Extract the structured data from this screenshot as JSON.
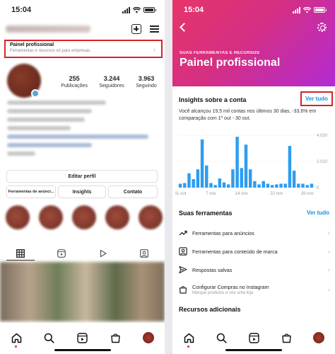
{
  "left": {
    "status_time": "15:04",
    "professional_panel": {
      "title": "Painel profissional",
      "subtitle": "Ferramentas e recursos só para empresas."
    },
    "stats": [
      {
        "value": "255",
        "label": "Publicações"
      },
      {
        "value": "3.244",
        "label": "Seguidores"
      },
      {
        "value": "3.963",
        "label": "Seguindo"
      }
    ],
    "buttons": {
      "edit_profile": "Editar perfil",
      "ad_tools": "Ferramentas de anúnci...",
      "insights": "Insights",
      "contact": "Contato"
    },
    "icons": [
      "plus-square-icon",
      "menu-icon",
      "grid-icon",
      "reels-icon",
      "play-icon",
      "tagged-icon"
    ]
  },
  "right": {
    "status_time": "15:04",
    "hero": {
      "eyebrow": "SUAS FERRAMENTAS E RECURSOS",
      "title": "Painel profissional"
    },
    "insights": {
      "title": "Insights sobre a conta",
      "see_all": "Ver tudo",
      "description": "Você alcançou 19,5 mil contas nos últimos 30 dias, -33,6% em comparação com 1º out - 30 out."
    },
    "tools": {
      "title": "Suas ferramentas",
      "see_all": "Ver tudo",
      "items": [
        {
          "label": "Ferramentas para anúncios",
          "icon": "trend-up-icon"
        },
        {
          "label": "Ferramentas para conteúdo de marca",
          "icon": "branded-content-icon"
        },
        {
          "label": "Respostas salvas",
          "icon": "send-icon"
        },
        {
          "label": "Configurar Compras no Instagram",
          "sublabel": "Marque produtos e crie uma loja",
          "icon": "shopping-bag-icon"
        }
      ]
    },
    "resources_title": "Recursos adicionais"
  },
  "colors": {
    "accent_blue": "#1a8fe3",
    "highlight_red": "#d4242a",
    "chart_bar": "#2e9df0",
    "hero_start": "#e6356a",
    "hero_end": "#b22bd4"
  },
  "chart_data": {
    "type": "bar",
    "categories": [
      "31 out",
      "1",
      "2",
      "3",
      "4",
      "5",
      "6",
      "7 nov",
      "8",
      "9",
      "10",
      "11",
      "12",
      "13",
      "14 nov",
      "15",
      "16",
      "17",
      "18",
      "19",
      "20",
      "21",
      "22 nov",
      "23",
      "24",
      "25",
      "26",
      "27",
      "28",
      "29 nov",
      "30"
    ],
    "x_tick_labels": [
      "31 out",
      "7 nov",
      "14 nov",
      "22 nov",
      "29 nov"
    ],
    "values": [
      300,
      350,
      1100,
      650,
      1400,
      3700,
      1700,
      350,
      200,
      700,
      400,
      250,
      1400,
      3900,
      1500,
      3300,
      1400,
      500,
      250,
      500,
      300,
      200,
      250,
      300,
      300,
      3200,
      1300,
      300,
      300,
      200,
      300
    ],
    "y_ticks": [
      "4.020",
      "2.010",
      "0"
    ],
    "ylim": [
      0,
      4020
    ]
  }
}
